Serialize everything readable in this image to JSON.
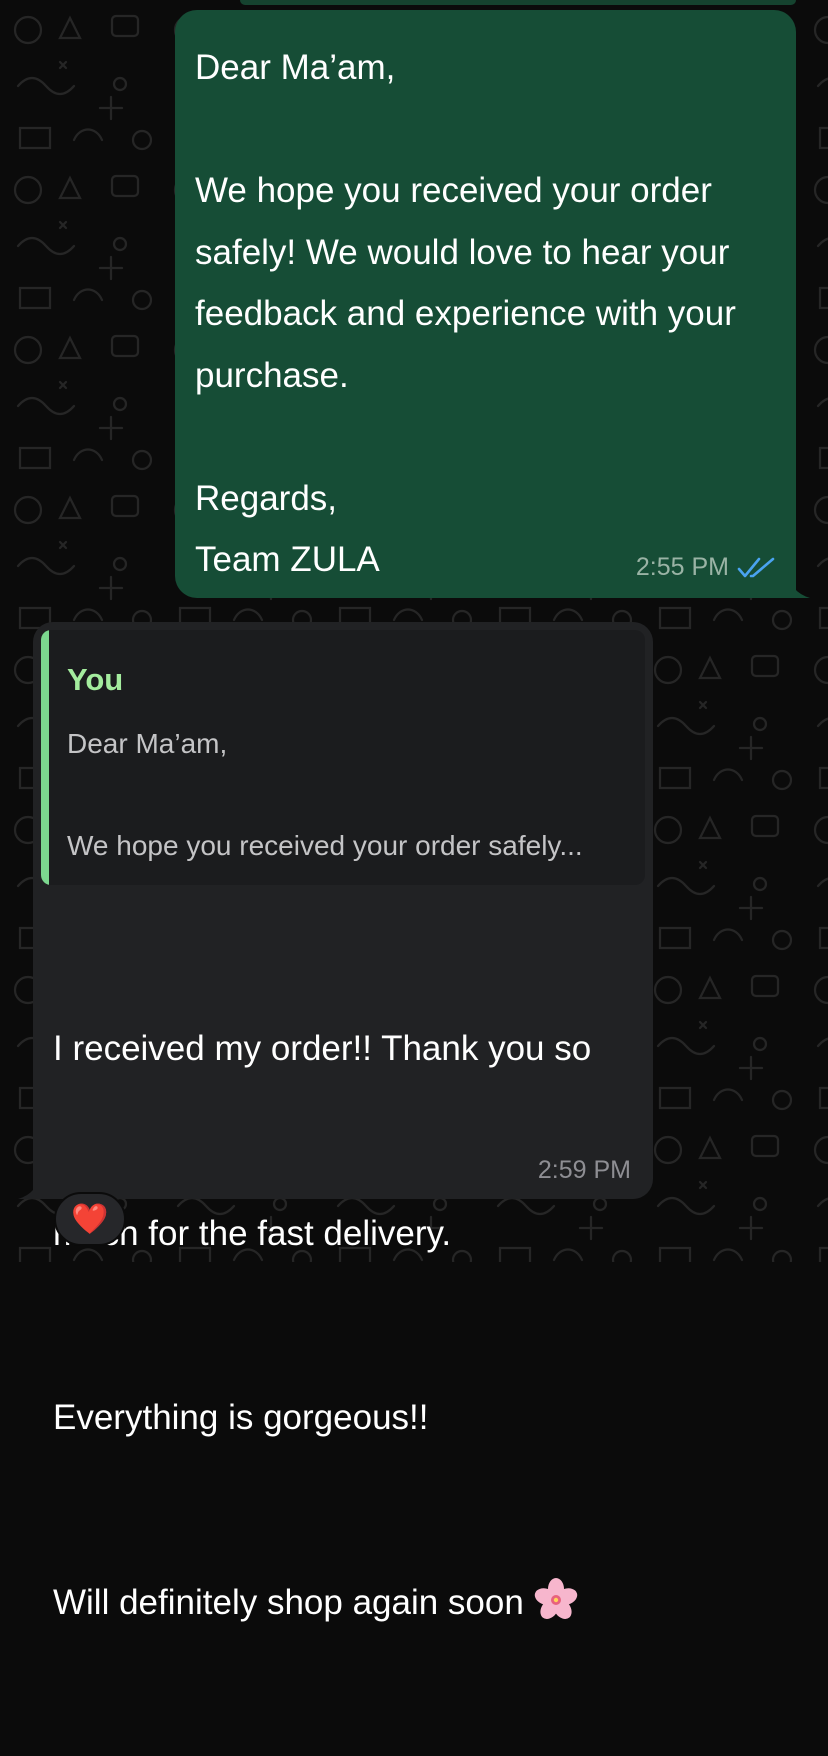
{
  "colors": {
    "background": "#0b0b0b",
    "outgoing_bubble": "#164d36",
    "incoming_bubble": "#212224",
    "quote_accent": "#7cd78f",
    "quote_author": "#a4ec9e",
    "read_ticks": "#4aa3f0"
  },
  "outgoing_message": {
    "text": "Dear Ma’am,\n\nWe hope you received your order safely! We would love to hear your feedback and experience with your purchase.\n\nRegards,\nTeam ZULA",
    "time": "2:55 PM",
    "status_icon": "double-check-read-icon"
  },
  "incoming_message": {
    "quote": {
      "author": "You",
      "line1": "Dear Ma’am,",
      "line2": "We hope you received your order safely..."
    },
    "lines": [
      "I received my order!! Thank you so",
      "much for the fast delivery.",
      "Everything is gorgeous!!",
      "Will definitely shop again soon"
    ],
    "trailing_emoji_icon": "cherry-blossom-icon",
    "time": "2:59 PM"
  },
  "reaction": {
    "emoji": "❤️"
  }
}
